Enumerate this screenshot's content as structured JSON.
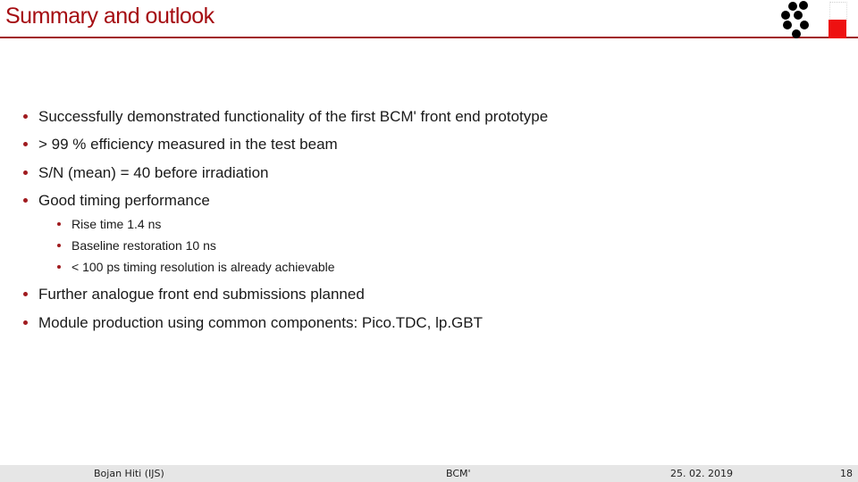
{
  "slide": {
    "title": "Summary and outlook",
    "accent_color": "#a50d12",
    "logos": [
      "dots-logo-icon",
      "ijs-logo-icon"
    ]
  },
  "bullets": [
    {
      "text": "Successfully demonstrated functionality of the first BCM' front end prototype"
    },
    {
      "text": "> 99 % efficiency measured in the test beam"
    },
    {
      "text": "S/N (mean) = 40 before irradiation"
    },
    {
      "text": "Good timing performance",
      "sub": [
        {
          "text": "Rise time 1.4 ns"
        },
        {
          "text": "Baseline restoration 10 ns"
        },
        {
          "text": "< 100 ps timing resolution is already achievable"
        }
      ]
    },
    {
      "text": "Further analogue front end submissions planned"
    },
    {
      "text": "Module production using common components: Pico.TDC, lp.GBT"
    }
  ],
  "footer": {
    "author": "Bojan Hiti (IJS)",
    "topic": "BCM'",
    "date": "25. 02. 2019",
    "page": "18"
  }
}
